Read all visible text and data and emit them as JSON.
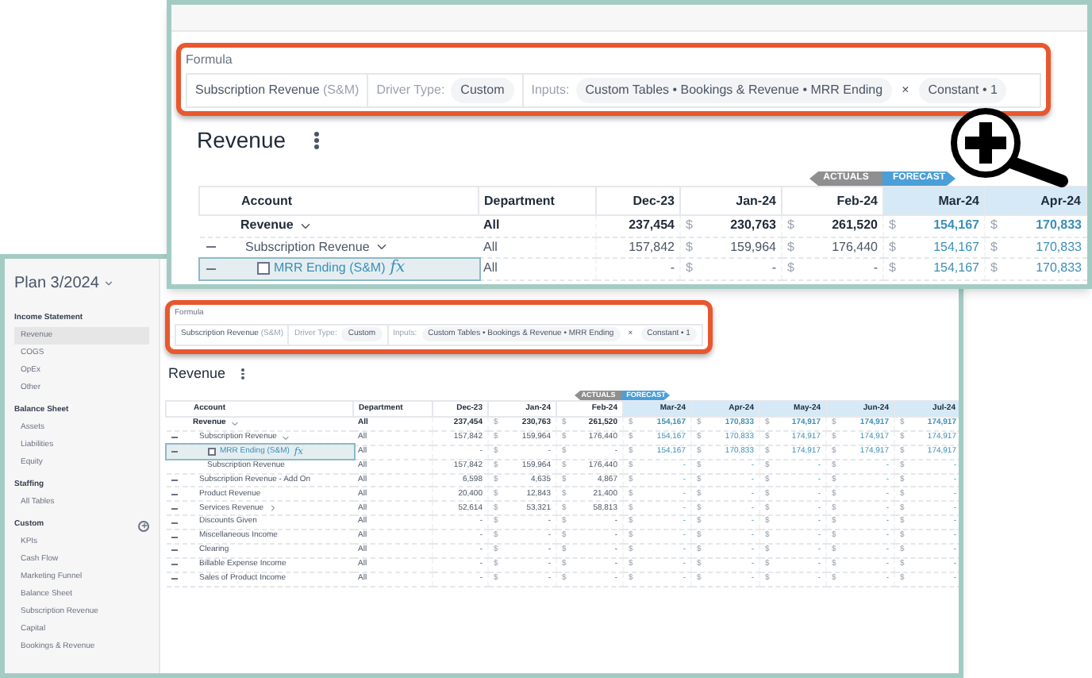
{
  "zoom_view": {
    "formula": {
      "label": "Formula",
      "account": "Subscription Revenue",
      "account_suffix": "(S&M)",
      "driver_type_label": "Driver Type:",
      "driver_type": "Custom",
      "inputs_label": "Inputs:",
      "inputs": "Custom Tables • Bookings & Revenue • MRR Ending",
      "remove": "×",
      "constant": "Constant • 1"
    },
    "table": {
      "title": "Revenue",
      "actuals": "ACTUALS",
      "forecast": "FORECAST",
      "account_header": "Account",
      "department_header": "Department",
      "months": [
        {
          "label": "Dec-23",
          "forecast": false
        },
        {
          "label": "Jan-24",
          "forecast": false
        },
        {
          "label": "Feb-24",
          "forecast": false
        },
        {
          "label": "Mar-24",
          "forecast": true
        },
        {
          "label": "Apr-24",
          "forecast": true
        }
      ],
      "rows": [
        {
          "kind": "total",
          "name": "Revenue",
          "expanded": true,
          "selected": false,
          "department": "All",
          "cells": [
            [
              "237,454"
            ],
            [
              "$",
              "230,763"
            ],
            [
              "$",
              "261,520"
            ],
            [
              "$",
              "154,167"
            ],
            [
              "$",
              "170,833"
            ]
          ]
        },
        {
          "kind": "group",
          "name": "Subscription Revenue",
          "expanded": true,
          "selected": false,
          "department": "All",
          "cells": [
            [
              "157,842"
            ],
            [
              "$",
              "159,964"
            ],
            [
              "$",
              "176,440"
            ],
            [
              "$",
              "154,167"
            ],
            [
              "$",
              "170,833"
            ]
          ]
        },
        {
          "kind": "formula",
          "name": "MRR Ending (S&M)",
          "formula_mark": "fx",
          "checked": false,
          "selected": true,
          "department": "All",
          "cells": [
            [
              "-"
            ],
            [
              "$",
              "-"
            ],
            [
              "$",
              "-"
            ],
            [
              "$",
              "154,167"
            ],
            [
              "$",
              "170,833"
            ]
          ]
        }
      ]
    }
  },
  "plan_window": {
    "sidebar": {
      "plan": "Plan 3/2024",
      "sections": [
        {
          "title": "Income Statement",
          "items": [
            {
              "label": "Revenue",
              "selected": true
            },
            {
              "label": "COGS",
              "selected": false
            },
            {
              "label": "OpEx",
              "selected": false
            },
            {
              "label": "Other",
              "selected": false
            }
          ]
        },
        {
          "title": "Balance Sheet",
          "items": [
            {
              "label": "Assets",
              "selected": false
            },
            {
              "label": "Liabilities",
              "selected": false
            },
            {
              "label": "Equity",
              "selected": false
            }
          ]
        },
        {
          "title": "Staffing",
          "items": [
            {
              "label": "All Tables",
              "selected": false
            }
          ]
        },
        {
          "title": "Custom",
          "add": true,
          "items": [
            {
              "label": "KPIs",
              "selected": false
            },
            {
              "label": "Cash Flow",
              "selected": false
            },
            {
              "label": "Marketing Funnel",
              "selected": false
            },
            {
              "label": "Balance Sheet",
              "selected": false
            },
            {
              "label": "Subscription Revenue",
              "selected": false
            },
            {
              "label": "Capital",
              "selected": false
            },
            {
              "label": "Bookings & Revenue",
              "selected": false
            }
          ]
        }
      ]
    },
    "formula": {
      "label": "Formula",
      "account": "Subscription Revenue",
      "account_suffix": "(S&M)",
      "driver_type_label": "Driver Type:",
      "driver_type": "Custom",
      "inputs_label": "Inputs:",
      "inputs": "Custom Tables • Bookings & Revenue • MRR Ending",
      "remove": "×",
      "constant": "Constant • 1"
    },
    "table": {
      "title": "Revenue",
      "actuals": "ACTUALS",
      "forecast": "FORECAST",
      "account_header": "Account",
      "department_header": "Department",
      "months": [
        {
          "label": "Dec-23",
          "forecast": false
        },
        {
          "label": "Jan-24",
          "forecast": false
        },
        {
          "label": "Feb-24",
          "forecast": false
        },
        {
          "label": "Mar-24",
          "forecast": true
        },
        {
          "label": "Apr-24",
          "forecast": true
        },
        {
          "label": "May-24",
          "forecast": true
        },
        {
          "label": "Jun-24",
          "forecast": true
        },
        {
          "label": "Jul-24",
          "forecast": true
        }
      ],
      "rows": [
        {
          "kind": "total",
          "name": "Revenue",
          "expanded": true,
          "selected": false,
          "department": "All",
          "cells": [
            [
              "237,454"
            ],
            [
              "$",
              "230,763"
            ],
            [
              "$",
              "261,520"
            ],
            [
              "$",
              "154,167"
            ],
            [
              "$",
              "170,833"
            ],
            [
              "$",
              "174,917"
            ],
            [
              "$",
              "174,917"
            ],
            [
              "$",
              "174,917"
            ]
          ]
        },
        {
          "kind": "group",
          "name": "Subscription Revenue",
          "expanded": true,
          "selected": false,
          "department": "All",
          "cells": [
            [
              "157,842"
            ],
            [
              "$",
              "159,964"
            ],
            [
              "$",
              "176,440"
            ],
            [
              "$",
              "154,167"
            ],
            [
              "$",
              "170,833"
            ],
            [
              "$",
              "174,917"
            ],
            [
              "$",
              "174,917"
            ],
            [
              "$",
              "174,917"
            ]
          ]
        },
        {
          "kind": "formula",
          "name": "MRR Ending (S&M)",
          "formula_mark": "fx",
          "checked": false,
          "selected": true,
          "department": "All",
          "cells": [
            [
              "-"
            ],
            [
              "$",
              "-"
            ],
            [
              "$",
              "-"
            ],
            [
              "$",
              "154,167"
            ],
            [
              "$",
              "170,833"
            ],
            [
              "$",
              "174,917"
            ],
            [
              "$",
              "174,917"
            ],
            [
              "$",
              "174,917"
            ]
          ]
        },
        {
          "kind": "child",
          "name": "Subscription Revenue",
          "selected": false,
          "department": "All",
          "cells": [
            [
              "157,842"
            ],
            [
              "$",
              "159,964"
            ],
            [
              "$",
              "176,440"
            ],
            [
              "$",
              "-"
            ],
            [
              "$",
              "-"
            ],
            [
              "$",
              "-"
            ],
            [
              "$",
              "-"
            ],
            [
              "$",
              "-"
            ]
          ]
        },
        {
          "kind": "line",
          "name": "Subscription Revenue - Add On",
          "selected": false,
          "department": "All",
          "cells": [
            [
              "6,598"
            ],
            [
              "$",
              "4,635"
            ],
            [
              "$",
              "4,867"
            ],
            [
              "$",
              "-"
            ],
            [
              "$",
              "-"
            ],
            [
              "$",
              "-"
            ],
            [
              "$",
              "-"
            ],
            [
              "$",
              "-"
            ]
          ]
        },
        {
          "kind": "line",
          "name": "Product Revenue",
          "selected": false,
          "department": "All",
          "cells": [
            [
              "20,400"
            ],
            [
              "$",
              "12,843"
            ],
            [
              "$",
              "21,400"
            ],
            [
              "$",
              "-"
            ],
            [
              "$",
              "-"
            ],
            [
              "$",
              "-"
            ],
            [
              "$",
              "-"
            ],
            [
              "$",
              "-"
            ]
          ]
        },
        {
          "kind": "line",
          "name": "Services Revenue",
          "expanded": false,
          "selected": false,
          "department": "All",
          "cells": [
            [
              "52,614"
            ],
            [
              "$",
              "53,321"
            ],
            [
              "$",
              "58,813"
            ],
            [
              "$",
              "-"
            ],
            [
              "$",
              "-"
            ],
            [
              "$",
              "-"
            ],
            [
              "$",
              "-"
            ],
            [
              "$",
              "-"
            ]
          ]
        },
        {
          "kind": "line",
          "name": "Discounts Given",
          "selected": false,
          "department": "All",
          "cells": [
            [
              "-"
            ],
            [
              "$",
              "-"
            ],
            [
              "$",
              "-"
            ],
            [
              "$",
              "-"
            ],
            [
              "$",
              "-"
            ],
            [
              "$",
              "-"
            ],
            [
              "$",
              "-"
            ],
            [
              "$",
              "-"
            ]
          ]
        },
        {
          "kind": "line",
          "name": "Miscellaneous Income",
          "selected": false,
          "department": "All",
          "cells": [
            [
              "-"
            ],
            [
              "$",
              "-"
            ],
            [
              "$",
              "-"
            ],
            [
              "$",
              "-"
            ],
            [
              "$",
              "-"
            ],
            [
              "$",
              "-"
            ],
            [
              "$",
              "-"
            ],
            [
              "$",
              "-"
            ]
          ]
        },
        {
          "kind": "line",
          "name": "Clearing",
          "selected": false,
          "department": "All",
          "cells": [
            [
              "-"
            ],
            [
              "$",
              "-"
            ],
            [
              "$",
              "-"
            ],
            [
              "$",
              "-"
            ],
            [
              "$",
              "-"
            ],
            [
              "$",
              "-"
            ],
            [
              "$",
              "-"
            ],
            [
              "$",
              "-"
            ]
          ]
        },
        {
          "kind": "line",
          "name": "Billable Expense Income",
          "selected": false,
          "department": "All",
          "cells": [
            [
              "-"
            ],
            [
              "$",
              "-"
            ],
            [
              "$",
              "-"
            ],
            [
              "$",
              "-"
            ],
            [
              "$",
              "-"
            ],
            [
              "$",
              "-"
            ],
            [
              "$",
              "-"
            ],
            [
              "$",
              "-"
            ]
          ]
        },
        {
          "kind": "line",
          "name": "Sales of Product Income",
          "selected": false,
          "department": "All",
          "cells": [
            [
              "-"
            ],
            [
              "$",
              "-"
            ],
            [
              "$",
              "-"
            ],
            [
              "$",
              "-"
            ],
            [
              "$",
              "-"
            ],
            [
              "$",
              "-"
            ],
            [
              "$",
              "-"
            ],
            [
              "$",
              "-"
            ]
          ]
        }
      ]
    }
  }
}
